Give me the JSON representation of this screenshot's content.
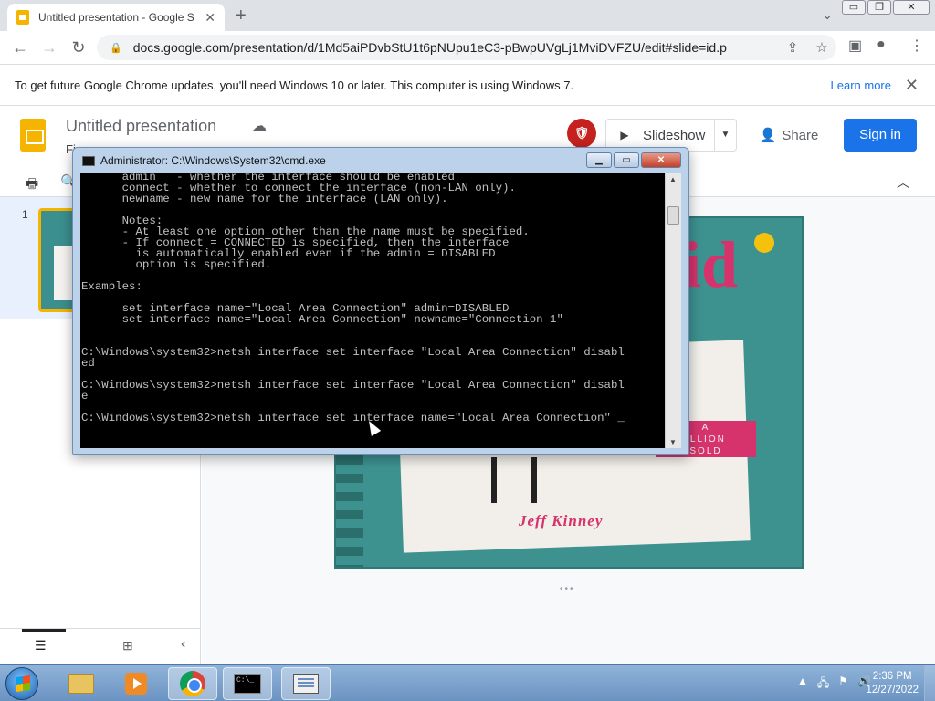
{
  "browser": {
    "tab_title": "Untitled presentation - Google S",
    "new_tab": "+",
    "tab_close": "✕",
    "url": "docs.google.com/presentation/d/1Md5aiPDvbStU1t6pNUpu1eC3-pBwpUVgLj1MviDVFZU/edit#slide=id.p",
    "window_controls": {
      "minimize": "▭",
      "restore": "❐",
      "close": "✕"
    }
  },
  "infobar": {
    "message": "To get future Google Chrome updates, you'll need Windows 10 or later. This computer is using Windows 7.",
    "learn_more": "Learn more",
    "close": "✕"
  },
  "slides": {
    "doc_title": "Untitled presentation",
    "menu_first": "Fi",
    "slideshow_label": "Slideshow",
    "share_label": "Share",
    "signin_label": "Sign in",
    "slide_number": "1"
  },
  "cover": {
    "title_fragment": "id",
    "banner_lines": [
      "A",
      "ILLION",
      "SOLD"
    ],
    "author": "Jeff Kinney"
  },
  "cmd": {
    "title": "Administrator: C:\\Windows\\System32\\cmd.exe",
    "lines": [
      "      admin   - whether the interface should be enabled",
      "      connect - whether to connect the interface (non-LAN only).",
      "      newname - new name for the interface (LAN only).",
      "",
      "      Notes:",
      "      - At least one option other than the name must be specified.",
      "      - If connect = CONNECTED is specified, then the interface",
      "        is automatically enabled even if the admin = DISABLED",
      "        option is specified.",
      "",
      "Examples:",
      "",
      "      set interface name=\"Local Area Connection\" admin=DISABLED",
      "      set interface name=\"Local Area Connection\" newname=\"Connection 1\"",
      "",
      "",
      "C:\\Windows\\system32>netsh interface set interface \"Local Area Connection\" disabl",
      "ed",
      "",
      "C:\\Windows\\system32>netsh interface set interface \"Local Area Connection\" disabl",
      "e",
      "",
      "C:\\Windows\\system32>netsh interface set interface name=\"Local Area Connection\" _"
    ]
  },
  "taskbar": {
    "cmd_icon_text": "C:\\_",
    "time": "2:36 PM",
    "date": "12/27/2022"
  }
}
